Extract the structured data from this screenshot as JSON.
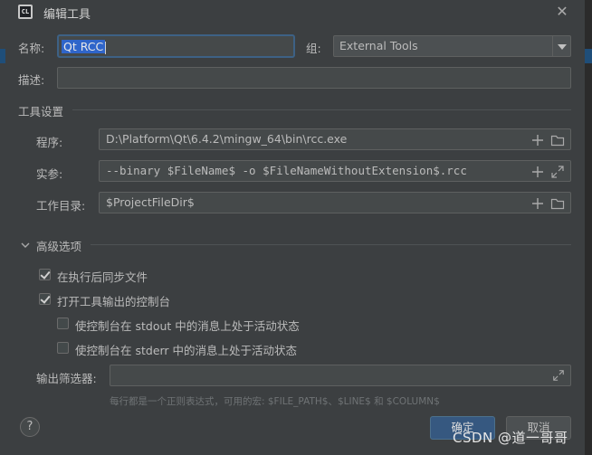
{
  "window": {
    "title": "编辑工具",
    "app_icon_text": "CL"
  },
  "form": {
    "name_label": "名称:",
    "name_value": "Qt RCC",
    "group_label": "组:",
    "group_value": "External Tools",
    "description_label": "描述:",
    "description_value": ""
  },
  "tool_settings": {
    "section_title": "工具设置",
    "program_label": "程序:",
    "program_value": "D:\\Platform\\Qt\\6.4.2\\mingw_64\\bin\\rcc.exe",
    "arguments_label": "实参:",
    "arguments_value": "--binary $FileName$ -o $FileNameWithoutExtension$.rcc",
    "working_dir_label": "工作目录:",
    "working_dir_value": "$ProjectFileDir$"
  },
  "advanced": {
    "section_title": "高级选项",
    "options": [
      {
        "label": "在执行后同步文件",
        "checked": true
      },
      {
        "label": "打开工具输出的控制台",
        "checked": true
      },
      {
        "label": "使控制台在 stdout 中的消息上处于活动状态",
        "checked": false
      },
      {
        "label": "使控制台在 stderr 中的消息上处于活动状态",
        "checked": false
      }
    ],
    "output_filter_label": "输出筛选器:",
    "output_filter_value": "",
    "hint": "每行都是一个正则表达式，可用的宏: $FILE_PATH$、$LINE$ 和 $COLUMN$"
  },
  "buttons": {
    "help": "?",
    "ok": "确定",
    "cancel": "取消"
  },
  "watermark": "CSDN @道一哥哥",
  "colors": {
    "background": "#3c3f41",
    "field": "#45494a",
    "border": "#5e6060",
    "focus": "#3d6185",
    "selection": "#2f65ca",
    "primary": "#365880"
  }
}
